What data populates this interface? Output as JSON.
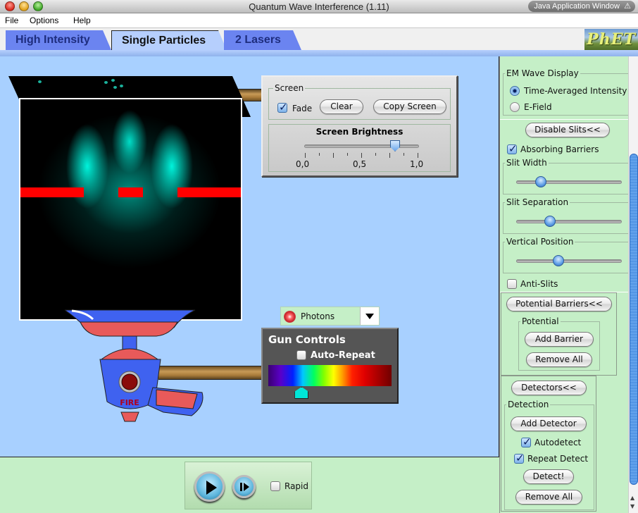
{
  "window": {
    "title": "Quantum Wave Interference (1.11)",
    "badge": "Java Application Window",
    "badge_icon": "warning-icon"
  },
  "menu": [
    "File",
    "Options",
    "Help"
  ],
  "tabs": [
    {
      "label": "High Intensity",
      "active": false
    },
    {
      "label": "Single Particles",
      "active": true
    },
    {
      "label": "2 Lasers",
      "active": false
    }
  ],
  "logo": "PhET",
  "screen_panel": {
    "group_title": "Screen",
    "fade_label": "Fade",
    "fade_checked": true,
    "clear_label": "Clear",
    "copy_label": "Copy Screen",
    "brightness_title": "Screen Brightness",
    "brightness_value": 0.8,
    "brightness_ticks": [
      "0,0",
      "0,5",
      "1,0"
    ]
  },
  "particle_select": {
    "value": "Photons",
    "icon": "photon-icon"
  },
  "gun_controls": {
    "title": "Gun Controls",
    "auto_repeat_label": "Auto-Repeat",
    "auto_repeat_checked": false,
    "wavelength_fraction": 0.27,
    "fire_label": "FIRE"
  },
  "clock": {
    "play_icon": "play-icon",
    "step_icon": "step-icon",
    "rapid_label": "Rapid",
    "rapid_checked": false
  },
  "control_panel": {
    "em_display": {
      "title": "EM Wave Display",
      "options": [
        {
          "label": "Time-Averaged Intensity",
          "selected": true
        },
        {
          "label": "E-Field",
          "selected": false
        }
      ]
    },
    "slits": {
      "toggle_label": "Disable Slits<<",
      "absorbing_label": "Absorbing Barriers",
      "absorbing_checked": true,
      "slit_width_title": "Slit Width",
      "slit_width_value": 0.23,
      "slit_separation_title": "Slit Separation",
      "slit_separation_value": 0.32,
      "vertical_position_title": "Vertical Position",
      "vertical_position_value": 0.4,
      "anti_slits_label": "Anti-Slits",
      "anti_slits_checked": false
    },
    "potential": {
      "toggle_label": "Potential Barriers<<",
      "group_title": "Potential",
      "add_label": "Add Barrier",
      "remove_label": "Remove All"
    },
    "detectors": {
      "toggle_label": "Detectors<<",
      "group_title": "Detection",
      "add_label": "Add Detector",
      "autodetect_label": "Autodetect",
      "autodetect_checked": true,
      "repeat_label": "Repeat Detect",
      "repeat_checked": true,
      "detect_label": "Detect!",
      "remove_label": "Remove All"
    }
  }
}
